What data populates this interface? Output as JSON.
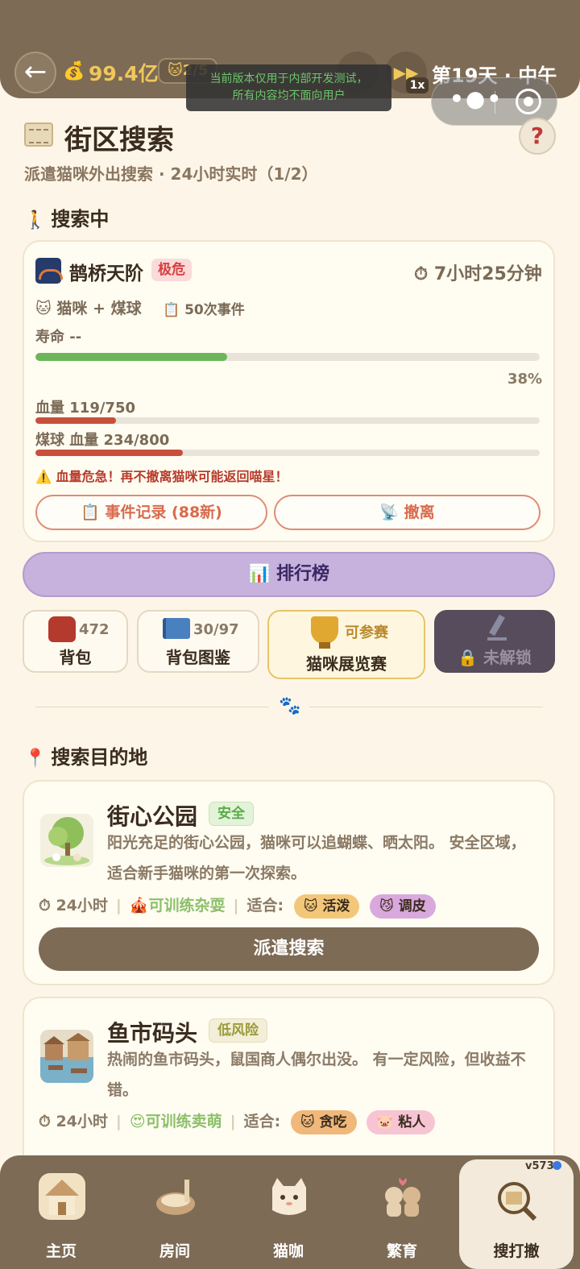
{
  "topbar": {
    "coins": "99.4亿",
    "cat_count": "2/5",
    "speed": "1x",
    "day": "第19天 · 中午"
  },
  "dev_banner": {
    "line1": "当前版本仅用于内部开发测试，",
    "line2": "所有内容均不面向用户"
  },
  "header": {
    "title": "街区搜索",
    "subtitle": "派遣猫咪外出搜索 · 24小时实时（1/2）",
    "help": "?"
  },
  "searching": {
    "section_label": "搜索中",
    "place": "鹊桥天阶",
    "danger": "极危",
    "timer": "7小时25分钟",
    "team": "猫咪 + 煤球",
    "events": "50次事件",
    "life_label": "寿命 --",
    "progress_percent": 38,
    "progress_label": "38%",
    "hp_cat_label": "血量 119/750",
    "hp_cat_fraction": 0.159,
    "hp_pet_label": "煤球 血量 234/800",
    "hp_pet_fraction": 0.2925,
    "warning": "⚠️ 血量危急！再不撤离猫咪可能返回喵星！",
    "log_button": "事件记录 (88新)",
    "retreat_button": "撤离"
  },
  "leaderboard": {
    "label": "排行榜"
  },
  "tiles": {
    "bag_count": "472",
    "bag_label": "背包",
    "collection_count": "30/97",
    "collection_label": "背包图鉴",
    "show_status": "可参赛",
    "show_label": "猫咪展览赛",
    "locked_label": "未解锁"
  },
  "destinations": {
    "section_label": "搜索目的地",
    "items": [
      {
        "name": "街心公园",
        "risk": "安全",
        "desc": "阳光充足的街心公园，猫咪可以追蝴蝶、晒太阳。 安全区域，适合新手猫咪的第一次探索。",
        "duration": "24小时",
        "train": "可训练杂耍",
        "fit_label": "适合:",
        "traits": [
          "活泼",
          "调皮"
        ],
        "button": "派遣搜索"
      },
      {
        "name": "鱼市码头",
        "risk": "低风险",
        "desc": "热闹的鱼市码头，鼠国商人偶尔出没。 有一定风险，但收益不错。",
        "duration": "24小时",
        "train": "可训练卖萌",
        "fit_label": "适合:",
        "traits": [
          "贪吃",
          "粘人"
        ]
      }
    ]
  },
  "nav": {
    "home": "主页",
    "room": "房间",
    "cafe": "猫咖",
    "breed": "繁育",
    "search": "搜打撤",
    "version": "v573"
  },
  "colors": {
    "accent_brown": "#7d6b55",
    "danger": "#d64040",
    "progress_green": "#6cb65a",
    "hp_red": "#c8503a",
    "leaderboard_purple": "#c7b1dd"
  }
}
